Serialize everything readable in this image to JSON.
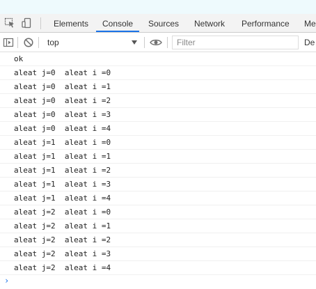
{
  "tabs": [
    "Elements",
    "Console",
    "Sources",
    "Network",
    "Performance",
    "Me"
  ],
  "active_tab": "Console",
  "toolbar": {
    "context": "top",
    "filter_placeholder": "Filter",
    "levels_label": "De"
  },
  "console_lines": [
    "ok",
    "aleat j=0  aleat i =0",
    "aleat j=0  aleat i =1",
    "aleat j=0  aleat i =2",
    "aleat j=0  aleat i =3",
    "aleat j=0  aleat i =4",
    "aleat j=1  aleat i =0",
    "aleat j=1  aleat i =1",
    "aleat j=1  aleat i =2",
    "aleat j=1  aleat i =3",
    "aleat j=1  aleat i =4",
    "aleat j=2  aleat i =0",
    "aleat j=2  aleat i =1",
    "aleat j=2  aleat i =2",
    "aleat j=2  aleat i =3",
    "aleat j=2  aleat i =4"
  ],
  "prompt_symbol": "›",
  "colors": {
    "accent": "#1a73e8",
    "tabbar_bg": "#f3f3f3",
    "top_strip": "#eefafd"
  },
  "icons": [
    "inspect-element-icon",
    "device-toggle-icon",
    "sidebar-toggle-icon",
    "clear-console-icon",
    "eye-icon"
  ]
}
